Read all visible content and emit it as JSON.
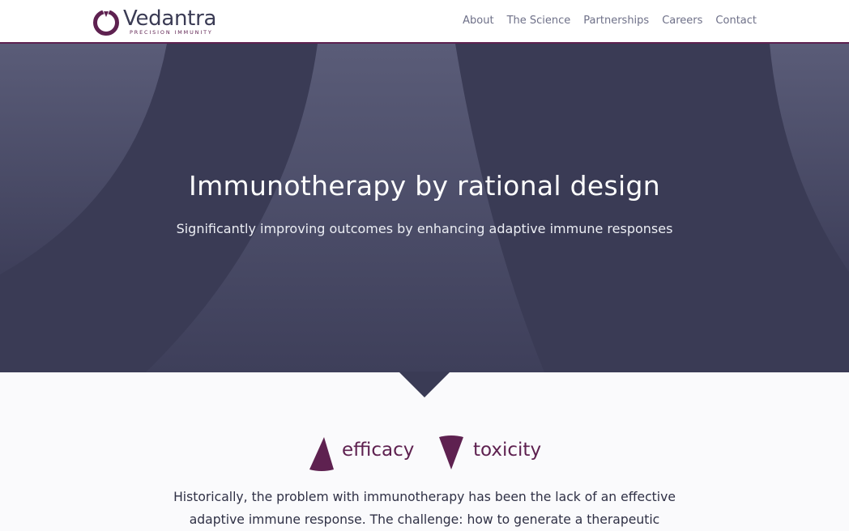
{
  "header": {
    "brand_name": "Vedantra",
    "brand_tagline": "PRECISION IMMUNITY",
    "nav": [
      "About",
      "The Science",
      "Partnerships",
      "Careers",
      "Contact"
    ]
  },
  "hero": {
    "title": "Immunotherapy by rational design",
    "subtitle": "Significantly improving outcomes by enhancing adaptive immune responses"
  },
  "ratio": {
    "up_label": "efficacy",
    "up_icon": "triangle-up-icon",
    "down_label": "toxicity",
    "down_icon": "triangle-down-icon"
  },
  "intro": {
    "text": "Historically, the problem with immunotherapy has been the lack of an effective adaptive immune response. The challenge: how to generate a therapeutic"
  },
  "colors": {
    "brand": "#5e2150",
    "hero_bg": "#3a3b55",
    "nav_text": "#6e7088"
  }
}
